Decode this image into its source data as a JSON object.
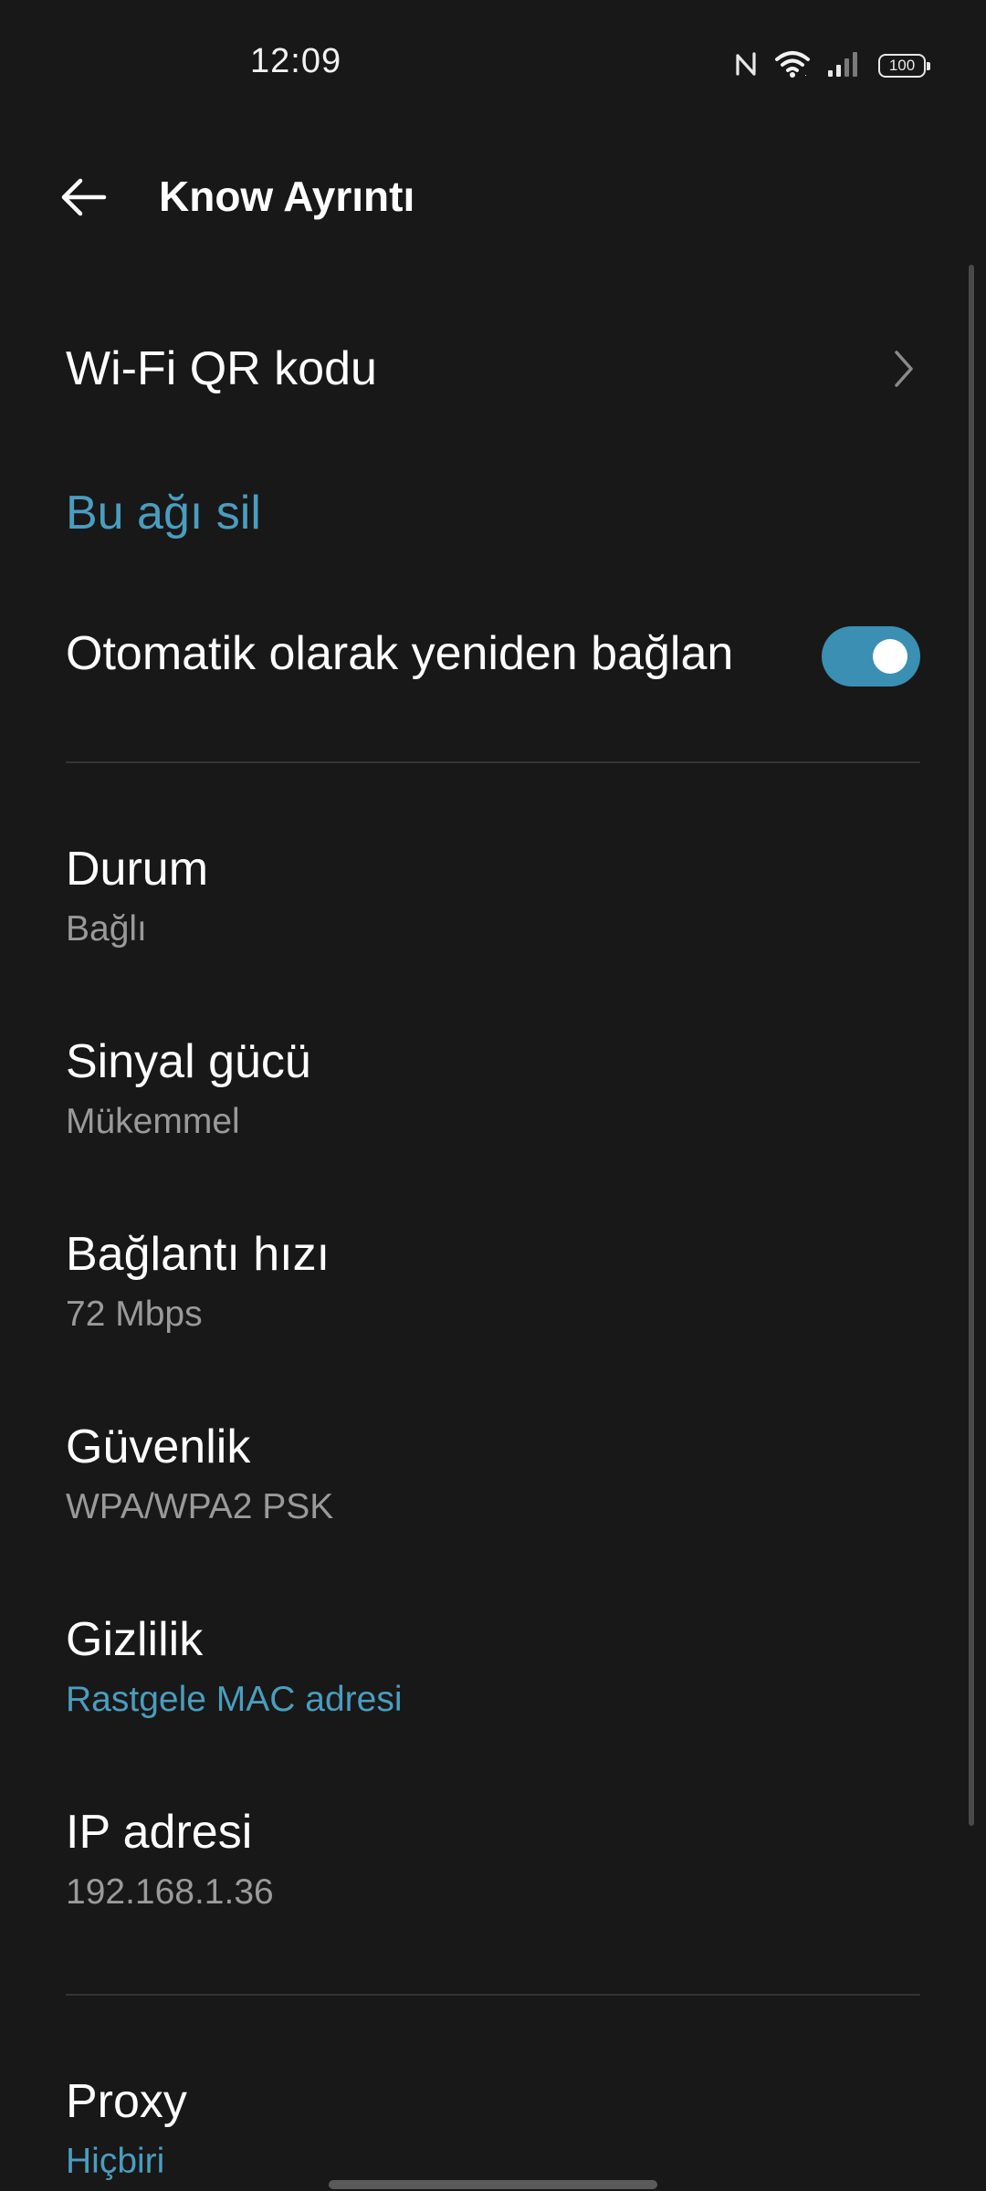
{
  "status_bar": {
    "time": "12:09",
    "battery": "100",
    "icons": [
      "nfc-icon",
      "wifi-icon",
      "signal-icon",
      "battery-icon"
    ]
  },
  "app_bar": {
    "back_icon": "back-arrow-icon",
    "title": "Know Ayrıntı"
  },
  "actions": {
    "wifi_qr": "Wi-Fi QR kodu",
    "forget": "Bu ağı sil",
    "auto_reconnect": "Otomatik olarak yeniden bağlan",
    "auto_reconnect_on": true
  },
  "details": {
    "status": {
      "label": "Durum",
      "value": "Bağlı"
    },
    "signal": {
      "label": "Sinyal gücü",
      "value": "Mükemmel"
    },
    "speed": {
      "label": "Bağlantı hızı",
      "value": "72 Mbps"
    },
    "security": {
      "label": "Güvenlik",
      "value": "WPA/WPA2 PSK"
    },
    "privacy": {
      "label": "Gizlilik",
      "value": "Rastgele MAC adresi"
    },
    "ip": {
      "label": "IP adresi",
      "value": "192.168.1.36"
    },
    "proxy": {
      "label": "Proxy",
      "value": "Hiçbiri"
    }
  },
  "colors": {
    "background": "#181818",
    "accent": "#4a9dbf",
    "secondary_text": "#9a9a9a"
  }
}
